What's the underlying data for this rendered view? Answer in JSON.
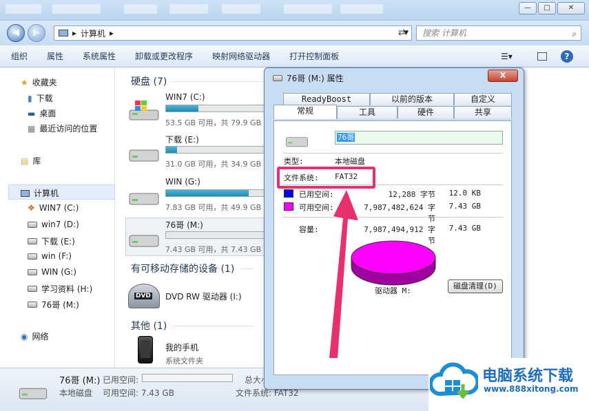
{
  "explorer": {
    "address": {
      "crumb": "计算机",
      "placeholder": "搜索 计算机"
    },
    "toolbar": [
      "组织",
      "属性",
      "系统属性",
      "卸载或更改程序",
      "映射网络驱动器",
      "打开控制面板"
    ],
    "sidebar": {
      "favorites": "收藏夹",
      "fav_items": [
        "下载",
        "桌面",
        "最近访问的位置"
      ],
      "library": "库",
      "computer": "计算机",
      "drives": [
        "WIN7 (C:)",
        "win7 (D:)",
        "下载 (E:)",
        "win (F:)",
        "WIN (G:)",
        "学习资料 (H:)",
        "76哥 (M:)"
      ],
      "network": "网络"
    },
    "groups": {
      "hdd": "硬盘 (7)",
      "removable": "有可移动存储的设备 (1)",
      "other": "其他 (1)"
    },
    "drives": [
      {
        "name": "WIN7 (C:)",
        "info": "53.5 GB 可用，共 79.9 GB",
        "used": 0.33
      },
      {
        "name": "下载 (E:)",
        "info": "31.0 GB 可用，共 34.9 GB",
        "used": 0.11
      },
      {
        "name": "WIN (G:)",
        "info": "7.83 GB 可用，共 49.9 GB",
        "used": 0.84
      },
      {
        "name": "76哥 (M:)",
        "info": "7.43 GB 可用，共 7.43 GB",
        "used": 0.0
      }
    ],
    "dvd": {
      "name": "DVD RW 驱动器 (I:)",
      "badge": "DVD"
    },
    "phone": {
      "name": "我的手机",
      "type": "系统文件夹"
    },
    "status": {
      "name": "76哥 (M:)",
      "type": "本地磁盘",
      "used_label": "已用空间:",
      "free_label": "可用空间: 7.43 GB",
      "total_label": "总大小",
      "fs_label": "文件系统: FAT32"
    }
  },
  "dialog": {
    "title": "76哥 (M:) 属性",
    "close": "X",
    "tabs_top": [
      "ReadyBoost",
      "以前的版本",
      "自定义"
    ],
    "tabs_bottom": [
      "常规",
      "工具",
      "硬件",
      "共享"
    ],
    "name_value": "76哥",
    "type_label": "类型:",
    "type_value": "本地磁盘",
    "fs_label": "文件系统:",
    "fs_value": "FAT32",
    "used_label": "已用空间:",
    "used_bytes": "12,288 字节",
    "used_size": "12.0 KB",
    "free_label": "可用空间:",
    "free_bytes": "7,987,482,624 字节",
    "free_size": "7.43 GB",
    "cap_label": "容量:",
    "cap_bytes": "7,987,494,912 字节",
    "cap_size": "7.43 GB",
    "drive_label": "驱动器 M:",
    "cleanup": "磁盘清理(D)",
    "colors": {
      "used": "#0000ff",
      "free": "#ff00ff"
    }
  },
  "watermark": {
    "title": "电脑系统下载",
    "url": "www.888xitong.com"
  }
}
